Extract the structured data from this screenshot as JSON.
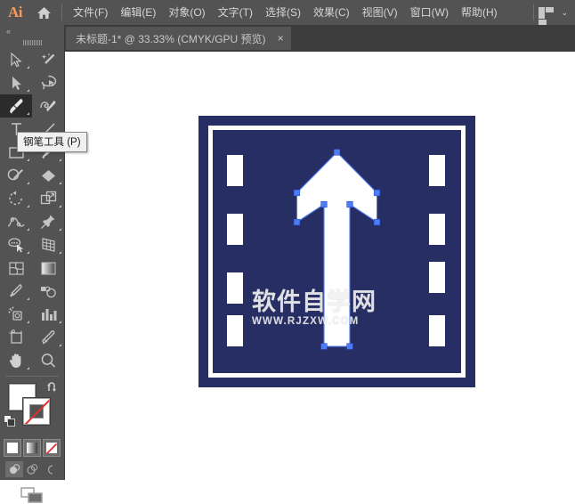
{
  "app": {
    "logo_text": "Ai",
    "home_icon": "home-icon",
    "workspace_icon": "workspace-switcher-icon",
    "workspace_caret": "⌄"
  },
  "menubar": {
    "items": [
      {
        "label": "文件(F)",
        "name": "menu-file"
      },
      {
        "label": "编辑(E)",
        "name": "menu-edit"
      },
      {
        "label": "对象(O)",
        "name": "menu-object"
      },
      {
        "label": "文字(T)",
        "name": "menu-type"
      },
      {
        "label": "选择(S)",
        "name": "menu-select"
      },
      {
        "label": "效果(C)",
        "name": "menu-effect"
      },
      {
        "label": "视图(V)",
        "name": "menu-view"
      },
      {
        "label": "窗口(W)",
        "name": "menu-window"
      },
      {
        "label": "帮助(H)",
        "name": "menu-help"
      }
    ]
  },
  "tabbar": {
    "document_title": "未标题-1* @ 33.33% (CMYK/GPU 预览)",
    "close_glyph": "×"
  },
  "toolbar": {
    "collapse_glyph": "«",
    "tools": [
      {
        "name": "selection-tool",
        "icon": "arrow-cursor-outline-icon",
        "corner": true,
        "selected": false
      },
      {
        "name": "magic-wand-tool",
        "icon": "magic-wand-icon",
        "corner": false,
        "selected": false
      },
      {
        "name": "direct-selection-tool",
        "icon": "arrow-cursor-solid-icon",
        "corner": true,
        "selected": false
      },
      {
        "name": "lasso-tool",
        "icon": "lasso-icon",
        "corner": false,
        "selected": false
      },
      {
        "name": "pen-tool",
        "icon": "pen-nib-icon",
        "corner": true,
        "selected": true
      },
      {
        "name": "curvature-tool",
        "icon": "curvature-pen-icon",
        "corner": false,
        "selected": false
      },
      {
        "name": "type-tool",
        "icon": "type-T-icon",
        "corner": true,
        "selected": false
      },
      {
        "name": "line-segment-tool",
        "icon": "line-segment-icon",
        "corner": true,
        "selected": false
      },
      {
        "name": "rectangle-tool",
        "icon": "rectangle-icon",
        "corner": true,
        "selected": false
      },
      {
        "name": "paintbrush-tool",
        "icon": "paintbrush-icon",
        "corner": true,
        "selected": false
      },
      {
        "name": "shaper-tool",
        "icon": "shaper-pencil-icon",
        "corner": true,
        "selected": false
      },
      {
        "name": "eraser-tool",
        "icon": "eraser-icon",
        "corner": true,
        "selected": false
      },
      {
        "name": "rotate-tool",
        "icon": "rotate-icon",
        "corner": true,
        "selected": false
      },
      {
        "name": "scale-tool",
        "icon": "scale-icon",
        "corner": true,
        "selected": false
      },
      {
        "name": "width-tool",
        "icon": "width-warp-icon",
        "corner": true,
        "selected": false
      },
      {
        "name": "free-transform-tool",
        "icon": "pushpin-icon",
        "corner": true,
        "selected": false
      },
      {
        "name": "shape-builder-tool",
        "icon": "shape-builder-icon",
        "corner": true,
        "selected": false
      },
      {
        "name": "perspective-grid-tool",
        "icon": "perspective-grid-icon",
        "corner": true,
        "selected": false
      },
      {
        "name": "mesh-tool",
        "icon": "mesh-icon",
        "corner": false,
        "selected": false
      },
      {
        "name": "gradient-tool",
        "icon": "gradient-icon",
        "corner": false,
        "selected": false
      },
      {
        "name": "eyedropper-tool",
        "icon": "eyedropper-icon",
        "corner": true,
        "selected": false
      },
      {
        "name": "blend-tool",
        "icon": "blend-icon",
        "corner": false,
        "selected": false
      },
      {
        "name": "symbol-sprayer-tool",
        "icon": "symbol-sprayer-icon",
        "corner": true,
        "selected": false
      },
      {
        "name": "column-graph-tool",
        "icon": "bar-graph-icon",
        "corner": true,
        "selected": false
      },
      {
        "name": "artboard-tool",
        "icon": "artboard-icon",
        "corner": false,
        "selected": false
      },
      {
        "name": "slice-tool",
        "icon": "slice-knife-icon",
        "corner": true,
        "selected": false
      },
      {
        "name": "hand-tool",
        "icon": "hand-icon",
        "corner": true,
        "selected": false
      },
      {
        "name": "zoom-tool",
        "icon": "magnifier-icon",
        "corner": false,
        "selected": false
      }
    ],
    "fill_color": "#ffffff",
    "stroke_color": "#ffffff",
    "stroke_is_none": true,
    "swap_icon": "swap-fill-stroke-icon",
    "default_icon": "default-fill-stroke-icon",
    "color_modes": [
      {
        "name": "color-mode-button",
        "icon": "solid-color-icon"
      },
      {
        "name": "gradient-mode-button",
        "icon": "gradient-swatch-icon"
      },
      {
        "name": "none-mode-button",
        "icon": "none-swatch-icon"
      }
    ],
    "draw_modes": [
      {
        "name": "draw-normal-button",
        "icon": "draw-normal-icon",
        "selected": true
      },
      {
        "name": "draw-behind-button",
        "icon": "draw-behind-icon",
        "selected": false
      },
      {
        "name": "draw-inside-button",
        "icon": "draw-inside-icon",
        "selected": false
      }
    ],
    "screen_mode": {
      "name": "change-screen-mode-button",
      "icon": "screen-mode-icon"
    }
  },
  "tooltip": {
    "text": "钢笔工具 (P)",
    "for_tool": "pen-tool"
  },
  "artwork": {
    "description": "straight-ahead-lane-road-sign",
    "sign_bg_color": "#262e63",
    "marking_color": "#ffffff",
    "anchor_color": "#4d7cf5",
    "selected_path": "arrow-shape",
    "left_dashes": 4,
    "right_dashes": 4
  },
  "watermark": {
    "cn": "软件自学网",
    "en": "WWW.RJZXW.COM"
  }
}
